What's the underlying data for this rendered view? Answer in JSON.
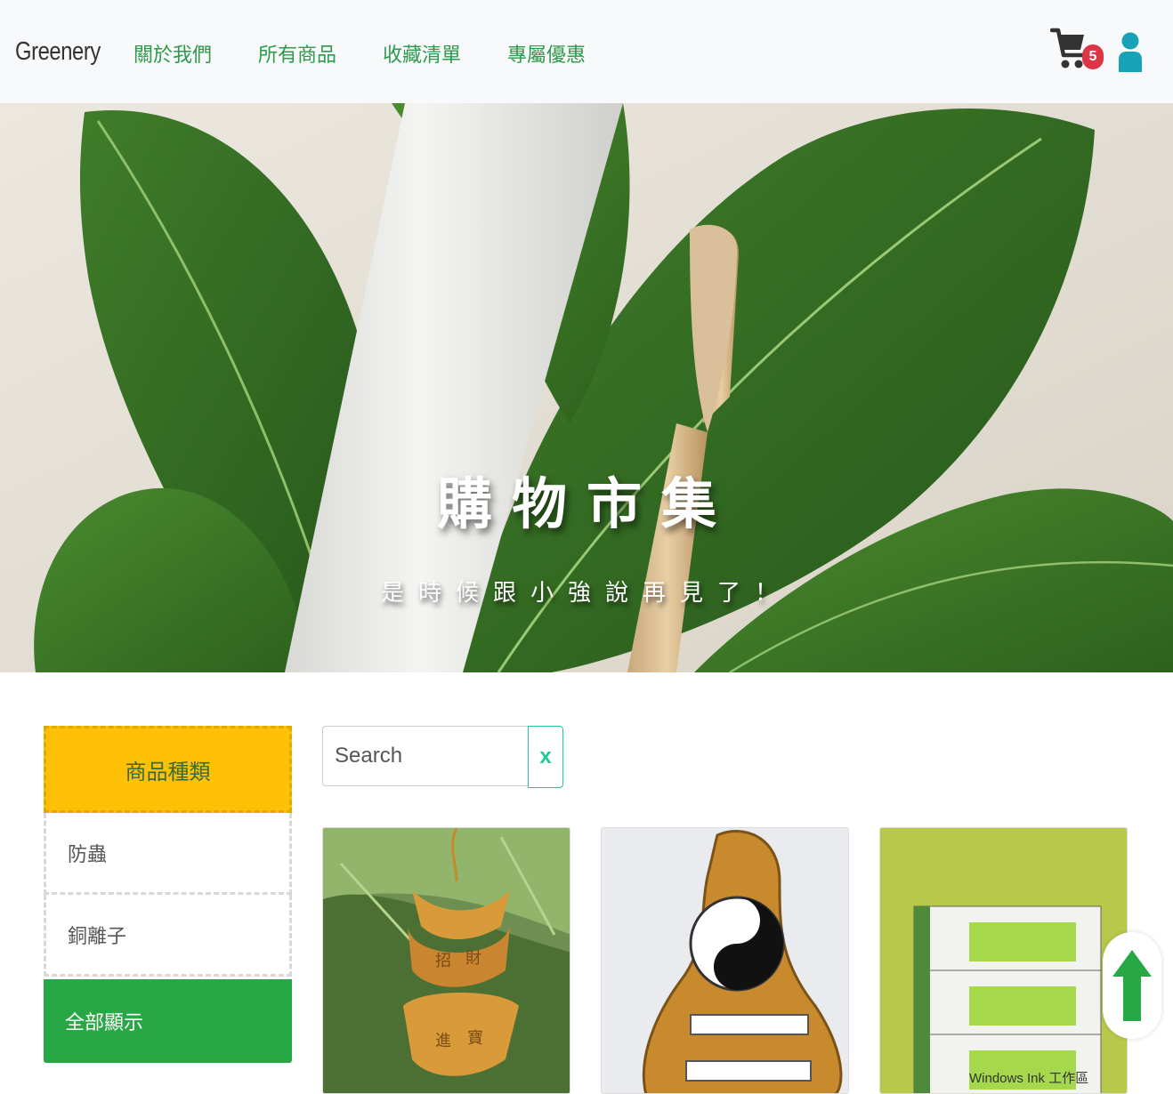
{
  "navbar": {
    "brand": "Greenery",
    "links": [
      "關於我們",
      "所有商品",
      "收藏清單",
      "專屬優惠"
    ],
    "cart_count": "5"
  },
  "hero": {
    "title": "購物市集",
    "subtitle": "是時候跟小強說再見了！"
  },
  "sidebar": {
    "header": "商品種類",
    "items": [
      "防蟲",
      "銅離子",
      "全部顯示"
    ]
  },
  "search": {
    "placeholder": "Search",
    "clear_label": "x"
  },
  "products": [
    {
      "image_text": [
        "招",
        "財",
        "進",
        "寶"
      ]
    },
    {
      "image_text": []
    },
    {
      "image_text": [
        "Windows Ink 工作區"
      ]
    }
  ],
  "colors": {
    "accent_green": "#28a745",
    "nav_link": "#2e9a4b",
    "category_header": "#ffc107",
    "badge": "#dc3545",
    "user_icon": "#17a2b8",
    "search_clear": "#20c997"
  }
}
